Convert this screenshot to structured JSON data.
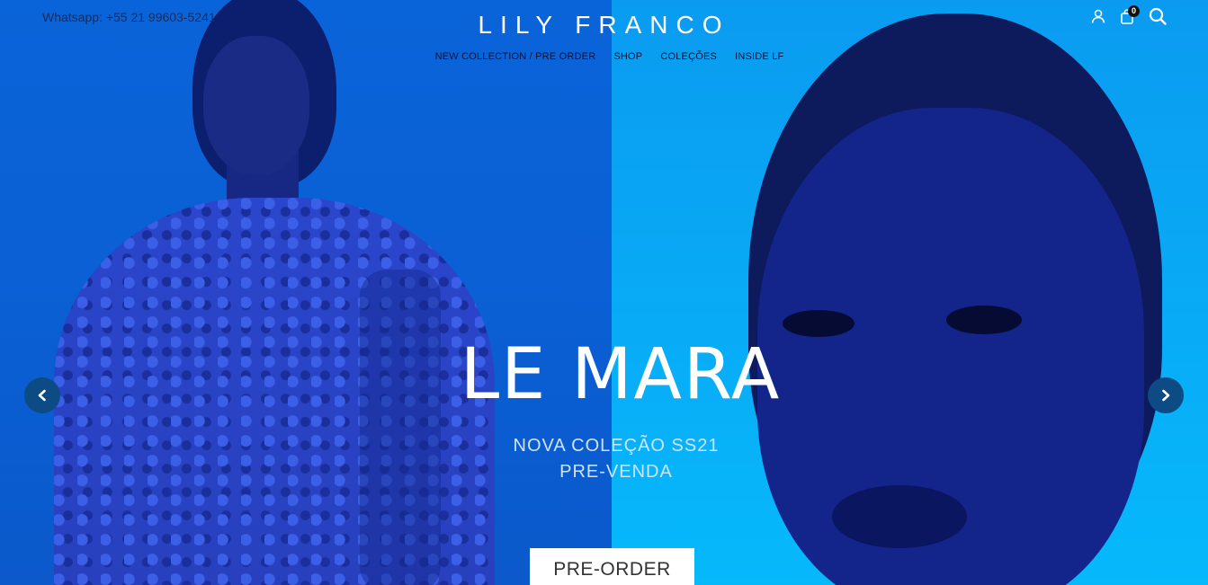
{
  "header": {
    "whatsapp": "Whatsapp: +55 21 99603-5241",
    "logo": "LILY FRANCO",
    "nav": [
      "NEW COLLECTION / PRE ORDER",
      "SHOP",
      "COLEÇÕES",
      "INSIDE LF"
    ],
    "cart_count": "0",
    "icons": [
      "user-icon",
      "cart-icon",
      "search-icon"
    ]
  },
  "hero": {
    "title": "LE MARA",
    "subtitle_line1": "NOVA COLEÇÃO SS21",
    "subtitle_line2": "PRE-VENDA",
    "cta_label": "PRE-ORDER",
    "prev_icon": "chevron-left-icon",
    "next_icon": "chevron-right-icon"
  },
  "colors": {
    "left_bg": "#0a64d9",
    "right_bg": "#09a8f5",
    "arrow_bg": "#0c4b84",
    "cta_bg": "#ffffff"
  }
}
